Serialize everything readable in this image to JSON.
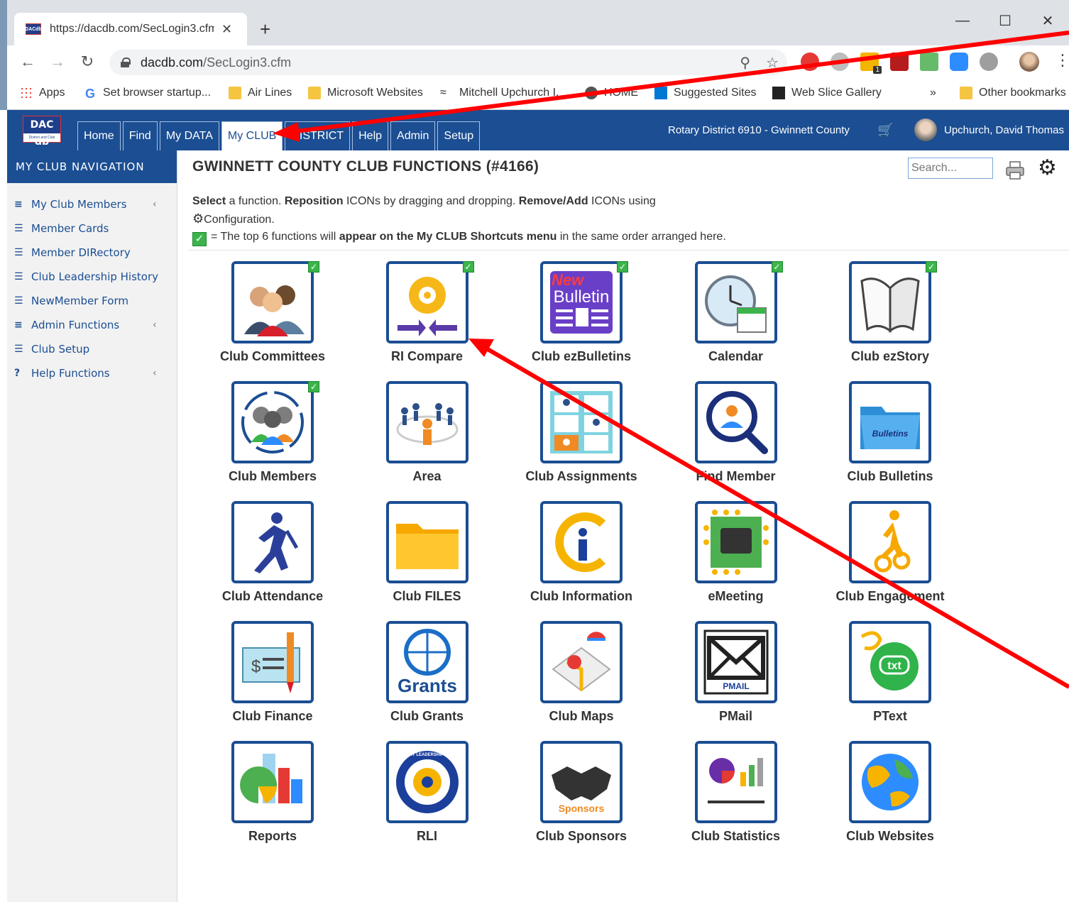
{
  "browser": {
    "tab_title": "https://dacdb.com/SecLogin3.cfm",
    "tab_favicon": "DACdb",
    "url_host": "dacdb.com",
    "url_path": "/SecLogin3.cfm",
    "bookmarks": [
      {
        "label": "Apps",
        "icon": "apps-icon"
      },
      {
        "label": "Set browser startup...",
        "icon": "google-icon"
      },
      {
        "label": "Air Lines",
        "icon": "folder-icon"
      },
      {
        "label": "Microsoft Websites",
        "icon": "folder-icon"
      },
      {
        "label": "Mitchell Upchurch I...",
        "icon": "swimmer-icon"
      },
      {
        "label": "HOME",
        "icon": "globe-icon"
      },
      {
        "label": "Suggested Sites",
        "icon": "bing-icon"
      },
      {
        "label": "Web Slice Gallery",
        "icon": "slice-icon"
      },
      {
        "label": "»",
        "icon": ""
      },
      {
        "label": "Other bookmarks",
        "icon": "folder-icon"
      }
    ],
    "extension_badge": "1"
  },
  "header": {
    "logo_text": "DAC db",
    "logo_sub": "District and Club database",
    "nav": [
      "Home",
      "Find",
      "My DATA",
      "My CLUB",
      "DISTRICT",
      "Help",
      "Admin",
      "Setup"
    ],
    "active_nav": "My CLUB",
    "district": "Rotary District 6910 - Gwinnett County",
    "user": "Upchurch, David Thomas"
  },
  "sidebar": {
    "title": "MY CLUB NAVIGATION",
    "items": [
      {
        "label": "My Club Members",
        "icon": "≡",
        "chevron": true
      },
      {
        "label": "Member Cards",
        "icon": "☰",
        "chevron": false
      },
      {
        "label": "Member DIRectory",
        "icon": "☰",
        "chevron": false
      },
      {
        "label": "Club Leadership History",
        "icon": "☰",
        "chevron": false
      },
      {
        "label": "NewMember Form",
        "icon": "☰",
        "chevron": false
      },
      {
        "label": "Admin Functions",
        "icon": "≡",
        "chevron": true
      },
      {
        "label": "Club Setup",
        "icon": "☰",
        "chevron": false
      },
      {
        "label": "Help Functions",
        "icon": "?",
        "chevron": true
      }
    ]
  },
  "main": {
    "title": "GWINNETT COUNTY CLUB FUNCTIONS (#4166)",
    "search_placeholder": "Search...",
    "instructions": {
      "l1_a": "Select",
      "l1_b": " a function. ",
      "l1_c": "Reposition",
      "l1_d": " ICONs by dragging and dropping. ",
      "l1_e": "Remove/Add",
      "l1_f": " ICONs using",
      "l2": "Configuration.",
      "l3_a": "= The top 6 functions will ",
      "l3_b": "appear on the My CLUB Shortcuts menu",
      "l3_c": " in the same order arranged here."
    },
    "tiles": [
      {
        "label": "Club Committees",
        "checked": true
      },
      {
        "label": "RI Compare",
        "checked": true
      },
      {
        "label": "Club ezBulletins",
        "checked": true
      },
      {
        "label": "Calendar",
        "checked": true
      },
      {
        "label": "Club ezStory",
        "checked": true
      },
      {
        "label": "Club Members",
        "checked": true
      },
      {
        "label": "Area",
        "checked": false
      },
      {
        "label": "Club Assignments",
        "checked": false
      },
      {
        "label": "Find Member",
        "checked": false
      },
      {
        "label": "Club Bulletins",
        "checked": false
      },
      {
        "label": "Club Attendance",
        "checked": false
      },
      {
        "label": "Club FILES",
        "checked": false
      },
      {
        "label": "Club Information",
        "checked": false
      },
      {
        "label": "eMeeting",
        "checked": false
      },
      {
        "label": "Club Engagement",
        "checked": false
      },
      {
        "label": "Club Finance",
        "checked": false
      },
      {
        "label": "Club Grants",
        "checked": false
      },
      {
        "label": "Club Maps",
        "checked": false
      },
      {
        "label": "PMail",
        "checked": false
      },
      {
        "label": "PText",
        "checked": false
      },
      {
        "label": "Reports",
        "checked": false
      },
      {
        "label": "RLI",
        "checked": false
      },
      {
        "label": "Club Sponsors",
        "checked": false
      },
      {
        "label": "Club Statistics",
        "checked": false
      },
      {
        "label": "Club Websites",
        "checked": false
      }
    ],
    "icon_texts": {
      "new": "New",
      "bulletin": "Bulletin",
      "bulletins_folder": "Bulletins",
      "grants": "Grants",
      "pmail": "PMAIL",
      "txt": "txt",
      "sponsors": "Sponsors",
      "rli_ring": "THE ROTARY LEADERSHIP INSTITUTE"
    }
  },
  "colors": {
    "brand_blue": "#1b4e93",
    "check_green": "#3cb44b",
    "annotation_red": "#ff0000"
  }
}
